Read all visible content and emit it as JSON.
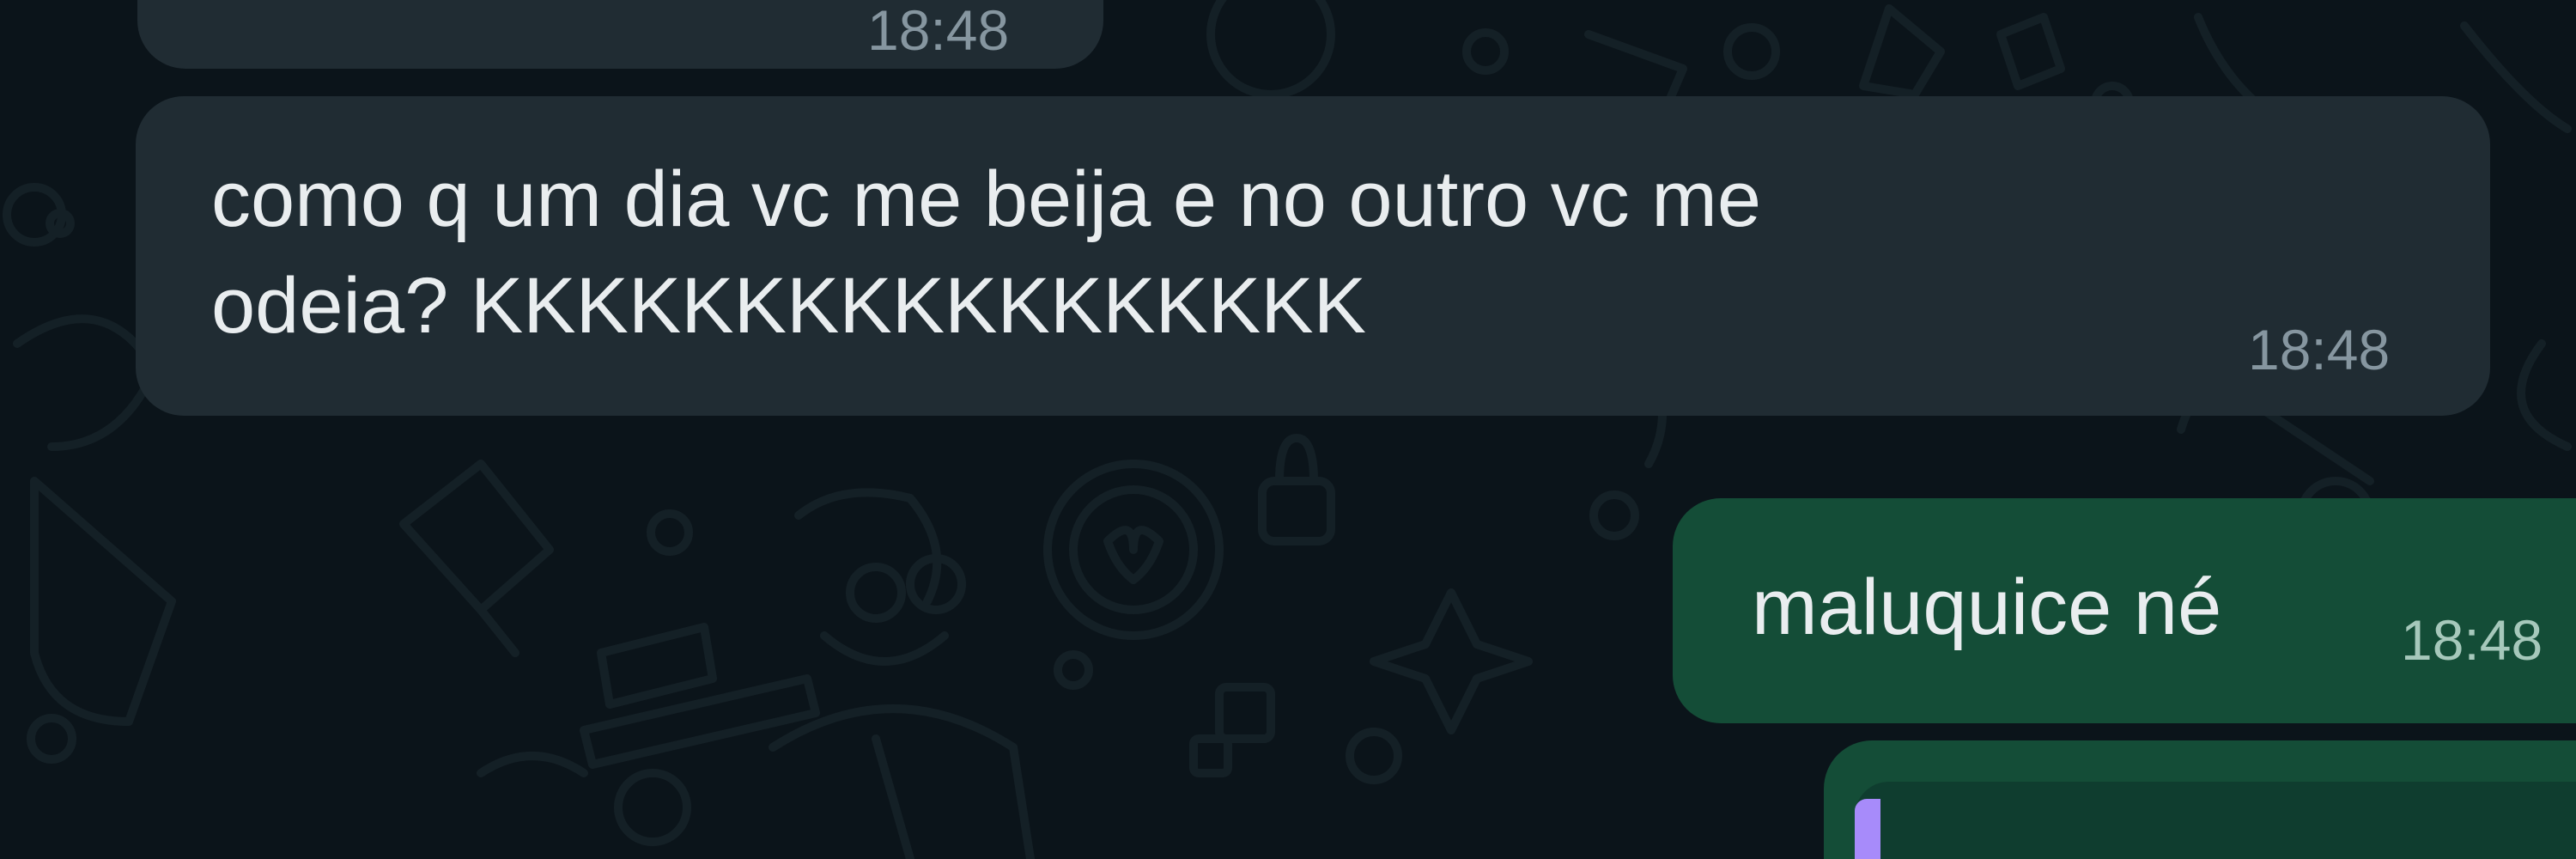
{
  "messages": [
    {
      "direction": "incoming",
      "text_line1": "",
      "time": "18:48",
      "partial": true
    },
    {
      "direction": "incoming",
      "text_line1": "como q um dia vc me beija e no outro vc me",
      "text_line2": "odeia? KKKKKKKKKKKKKKKKK",
      "time": "18:48"
    },
    {
      "direction": "outgoing",
      "text_line1": "maluquice né",
      "time": "18:48"
    },
    {
      "direction": "outgoing",
      "quoted_reply": true,
      "accent_color": "#a78bfa",
      "partial": true
    }
  ],
  "theme": {
    "background": "#0b141a",
    "incoming_bubble": "#202c33",
    "outgoing_bubble": "#144d37",
    "text": "#e9edef",
    "timestamp": "#8696a0"
  }
}
